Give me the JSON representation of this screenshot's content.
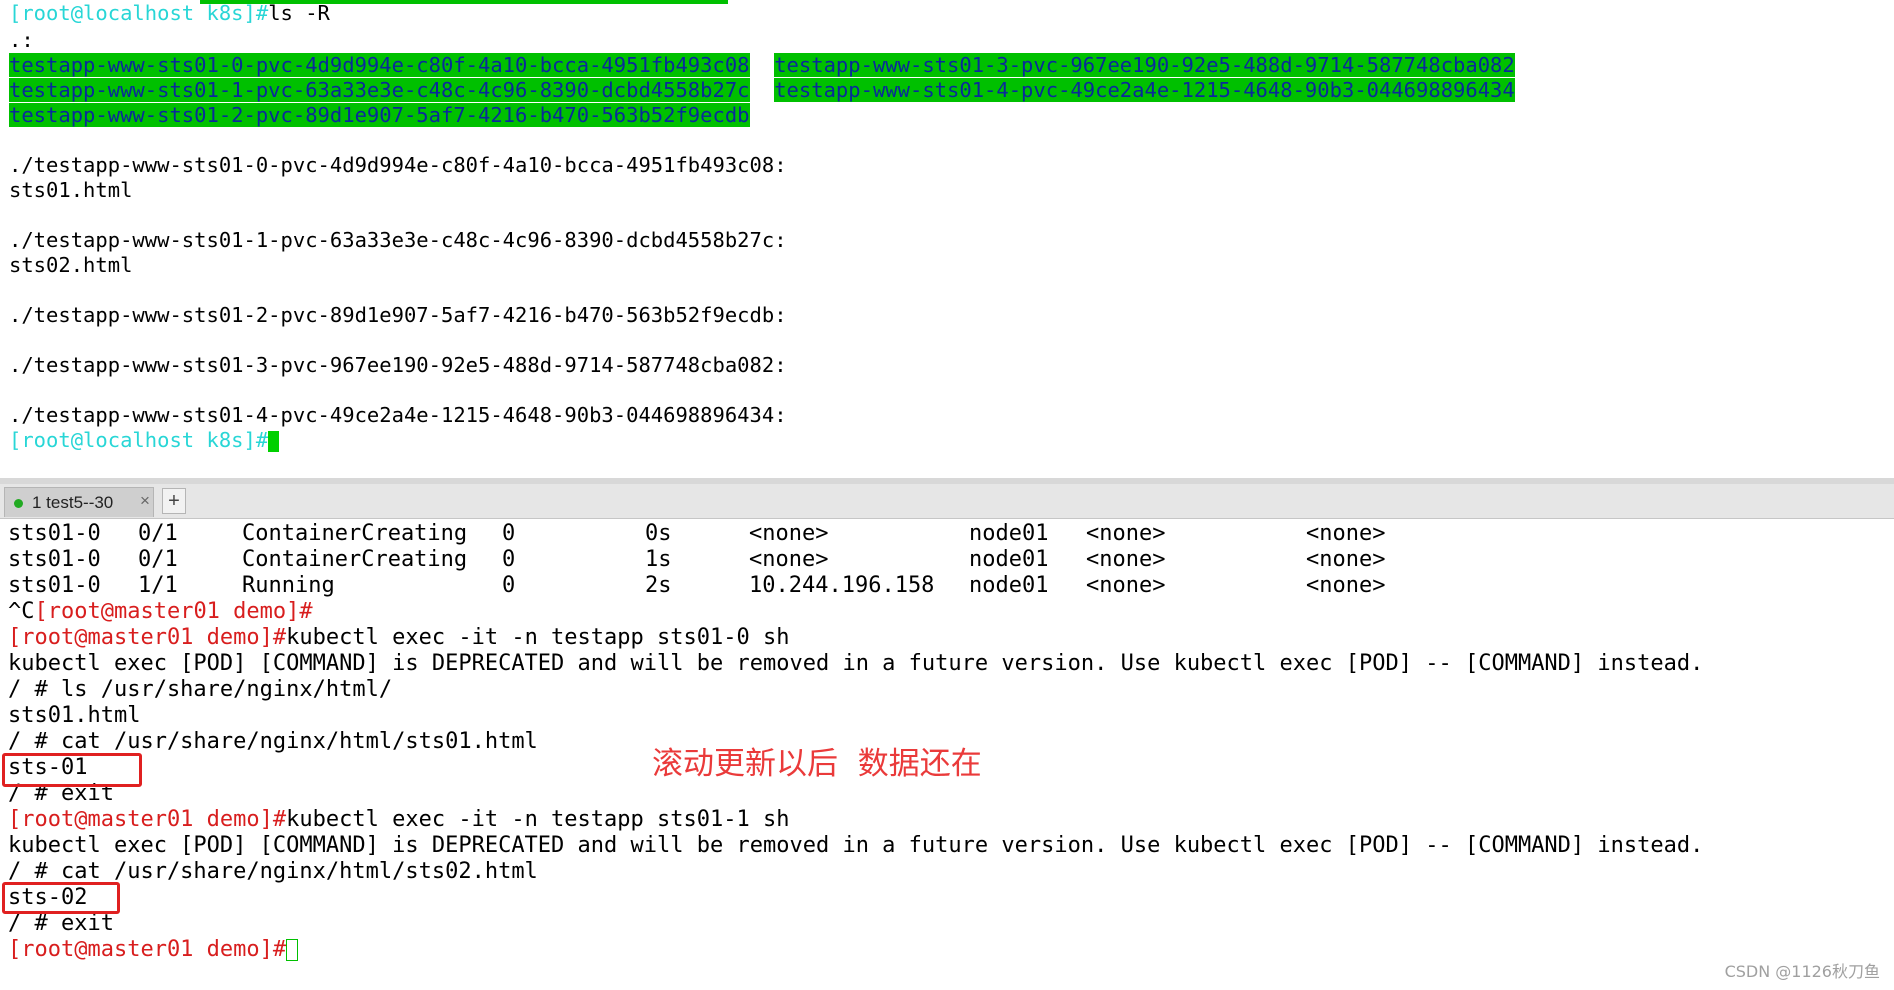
{
  "top_terminal": {
    "prompt": "[root@localhost k8s]#",
    "command": "ls -R",
    "dot_line": ".:",
    "pvc_dirs_col1": [
      "testapp-www-sts01-0-pvc-4d9d994e-c80f-4a10-bcca-4951fb493c08",
      "testapp-www-sts01-1-pvc-63a33e3e-c48c-4c96-8390-dcbd4558b27c",
      "testapp-www-sts01-2-pvc-89d1e907-5af7-4216-b470-563b52f9ecdb"
    ],
    "pvc_dirs_col2": [
      "testapp-www-sts01-3-pvc-967ee190-92e5-488d-9714-587748cba082",
      "testapp-www-sts01-4-pvc-49ce2a4e-1215-4648-90b3-044698896434"
    ],
    "listing": [
      "./testapp-www-sts01-0-pvc-4d9d994e-c80f-4a10-bcca-4951fb493c08:",
      "sts01.html",
      "./testapp-www-sts01-1-pvc-63a33e3e-c48c-4c96-8390-dcbd4558b27c:",
      "sts02.html",
      "./testapp-www-sts01-2-pvc-89d1e907-5af7-4216-b470-563b52f9ecdb:",
      "./testapp-www-sts01-3-pvc-967ee190-92e5-488d-9714-587748cba082:",
      "./testapp-www-sts01-4-pvc-49ce2a4e-1215-4648-90b3-044698896434:"
    ],
    "final_prompt": "[root@localhost k8s]#"
  },
  "tab_bar": {
    "tab_label": "1 test5--30",
    "close_glyph": "×",
    "add_glyph": "+"
  },
  "bottom_terminal": {
    "pod_rows": [
      [
        "sts01-0",
        "0/1",
        "ContainerCreating",
        "0",
        "0s",
        "<none>",
        "node01",
        "<none>",
        "<none>"
      ],
      [
        "sts01-0",
        "0/1",
        "ContainerCreating",
        "0",
        "1s",
        "<none>",
        "node01",
        "<none>",
        "<none>"
      ],
      [
        "sts01-0",
        "1/1",
        "Running",
        "0",
        "2s",
        "10.244.196.158",
        "node01",
        "<none>",
        "<none>"
      ]
    ],
    "interrupt": "^C",
    "prompt": "[root@master01 demo]#",
    "exec_cmd_1": "kubectl exec -it -n testapp sts01-0 sh",
    "deprecated_msg": "kubectl exec [POD] [COMMAND] is DEPRECATED and will be removed in a future version. Use kubectl exec [POD] -- [COMMAND] instead.",
    "ls_cmd": "/ # ls /usr/share/nginx/html/",
    "ls_out": "sts01.html",
    "cat_cmd_1": "/ # cat /usr/share/nginx/html/sts01.html",
    "cat_out_1": "sts-01",
    "exit_1": "/ # exit",
    "exec_cmd_2": "kubectl exec -it -n testapp sts01-1 sh",
    "cat_cmd_2": "/ # cat /usr/share/nginx/html/sts02.html",
    "cat_out_2": "sts-02",
    "exit_2": "/ # exit"
  },
  "annotation": "滚动更新以后  数据还在",
  "watermark": "CSDN @1126秋刀鱼",
  "colors": {
    "prompt_top": "#28d6d6",
    "highlight_bg": "#00c000",
    "highlight_text": "#0a2a9a",
    "prompt_bottom": "#d81e1e",
    "annotation": "#ea3a3a",
    "box": "#e02020"
  }
}
